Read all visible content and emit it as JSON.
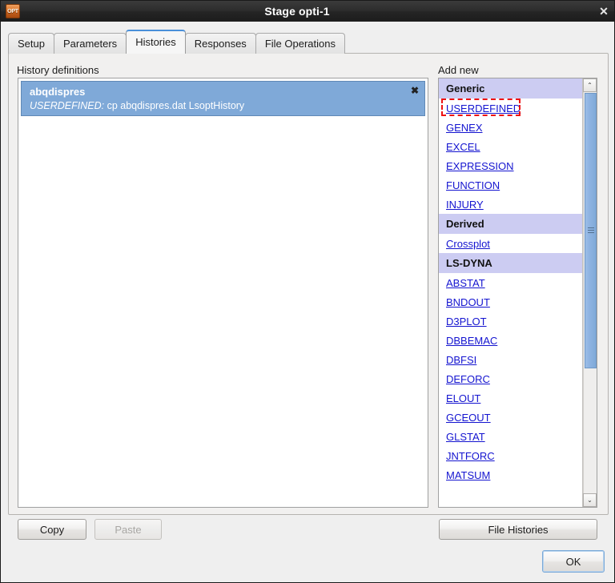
{
  "window": {
    "title": "Stage opti-1",
    "icon_name": "opt-app-icon",
    "icon_text": "OPT",
    "close_glyph": "✕"
  },
  "tabs": [
    {
      "label": "Setup",
      "selected": false
    },
    {
      "label": "Parameters",
      "selected": false
    },
    {
      "label": "Histories",
      "selected": true
    },
    {
      "label": "Responses",
      "selected": false
    },
    {
      "label": "File Operations",
      "selected": false
    }
  ],
  "left_panel": {
    "label": "History definitions",
    "items": [
      {
        "name": "abqdispres",
        "type": "USERDEFINED:",
        "command": "cp abqdispres.dat LsoptHistory",
        "close_glyph": "✖",
        "selected": true
      }
    ]
  },
  "right_panel": {
    "label": "Add new",
    "groups": [
      {
        "title": "Generic",
        "items": [
          "USERDEFINED",
          "GENEX",
          "EXCEL",
          "EXPRESSION",
          "FUNCTION",
          "INJURY"
        ]
      },
      {
        "title": "Derived",
        "items": [
          "Crossplot"
        ]
      },
      {
        "title": "LS-DYNA",
        "items": [
          "ABSTAT",
          "BNDOUT",
          "D3PLOT",
          "DBBEMAC",
          "DBFSI",
          "DEFORC",
          "ELOUT",
          "GCEOUT",
          "GLSTAT",
          "JNTFORC",
          "MATSUM"
        ]
      }
    ],
    "highlighted_item": "USERDEFINED",
    "scrollbar": {
      "up_glyph": "⌃",
      "down_glyph": "⌄"
    }
  },
  "buttons": {
    "copy": "Copy",
    "paste": "Paste",
    "file_histories": "File Histories",
    "ok": "OK"
  },
  "colors": {
    "selection_blue": "#7fa9d8",
    "group_header_lavender": "#ccccf2",
    "link_blue": "#1414d0",
    "highlight_red": "#ee1111",
    "tab_accent": "#4a90d9"
  }
}
